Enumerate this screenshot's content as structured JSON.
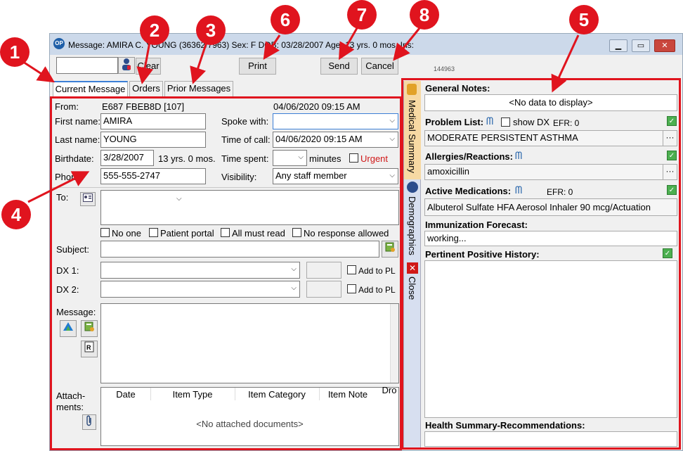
{
  "window": {
    "title": "Message: AMIRA C. YOUNG (36362/7963)  Sex: F  DOB: 03/28/2007  Age: 13 yrs. 0 mos.  Ins:",
    "app_icon": "OP",
    "minimize": "▁",
    "maximize": "▭",
    "close": "✕"
  },
  "toolbar": {
    "clear_label": "Clear",
    "print_label": "Print",
    "send_label": "Send",
    "cancel_label": "Cancel",
    "id_text": "144963"
  },
  "tabs": [
    {
      "label": "Current Message"
    },
    {
      "label": "Orders"
    },
    {
      "label": "Prior Messages"
    }
  ],
  "form": {
    "from_label": "From:",
    "from_value": "E687 FBEB8D [107]",
    "from_date": "04/06/2020 09:15 AM",
    "first_name_label": "First name:",
    "first_name": "AMIRA",
    "last_name_label": "Last name:",
    "last_name": "YOUNG",
    "birthdate_label": "Birthdate:",
    "birthdate": "3/28/2007",
    "age": "13 yrs. 0 mos.",
    "phone_label": "Phone:",
    "phone": "555-555-2747",
    "spoke_with_label": "Spoke with:",
    "spoke_with": "",
    "time_of_call_label": "Time of call:",
    "time_of_call": "04/06/2020 09:15 AM",
    "time_spent_label": "Time spent:",
    "minutes_label": "minutes",
    "urgent_label": "Urgent",
    "visibility_label": "Visibility:",
    "visibility": "Any staff member",
    "to_label": "To:",
    "no_one": "No one",
    "patient_portal": "Patient portal",
    "all_must_read": "All must read",
    "no_response": "No response allowed",
    "subject_label": "Subject:",
    "dx1_label": "DX 1:",
    "dx2_label": "DX 2:",
    "add_to_pl": "Add to PL",
    "message_label": "Message:",
    "attachments_label_1": "Attach-",
    "attachments_label_2": "ments:",
    "attach_columns": [
      "Date",
      "Item Type",
      "Item Category",
      "Item Note",
      "Dro"
    ],
    "no_attached": "<No attached documents>"
  },
  "side_tabs": {
    "medical_summary": "Medical Summary",
    "demographics": "Demographics",
    "close": "Close"
  },
  "summary": {
    "general_notes_label": "General Notes:",
    "no_data": "<No data to display>",
    "problem_list_label": "Problem List:",
    "show_dx": "show DX",
    "efr_problem": "EFR: 0",
    "problem_item": "MODERATE PERSISTENT ASTHMA",
    "allergies_label": "Allergies/Reactions:",
    "allergy_item": "amoxicillin",
    "active_meds_label": "Active Medications:",
    "efr_meds": "EFR: 0",
    "med_item": "Albuterol Sulfate HFA Aerosol Inhaler 90 mcg/Actuation",
    "immunization_label": "Immunization Forecast:",
    "immunization_value": "working...",
    "pertinent_label": "Pertinent Positive History:",
    "health_summary_label": "Health Summary-Recommendations:",
    "ellipsis": "···",
    "sync_icon": "ᗰ"
  },
  "callouts": [
    "1",
    "2",
    "3",
    "4",
    "5",
    "6",
    "7",
    "8"
  ]
}
